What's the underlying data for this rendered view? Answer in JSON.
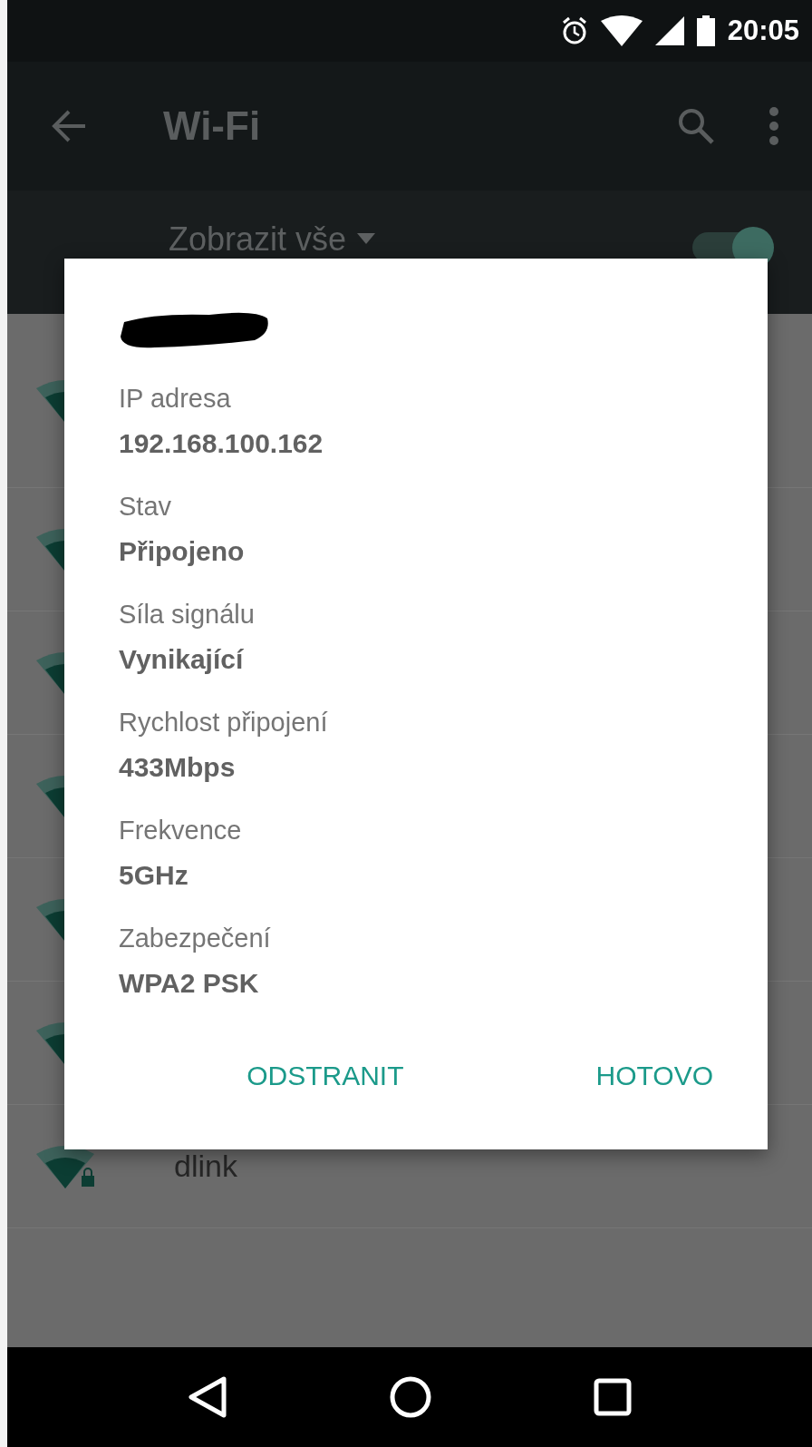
{
  "status_bar": {
    "time": "20:05"
  },
  "toolbar": {
    "title": "Wi-Fi"
  },
  "filter": {
    "label": "Zobrazit vše",
    "wifi_switch": {
      "on": true
    }
  },
  "networks": [
    {
      "name": "dlink",
      "locked": true
    }
  ],
  "dialog": {
    "fields": [
      {
        "label": "IP adresa",
        "value": "192.168.100.162"
      },
      {
        "label": "Stav",
        "value": "Připojeno"
      },
      {
        "label": "Síla signálu",
        "value": "Vynikající"
      },
      {
        "label": "Rychlost připojení",
        "value": "433Mbps"
      },
      {
        "label": "Frekvence",
        "value": "5GHz"
      },
      {
        "label": "Zabezpečení",
        "value": "WPA2 PSK"
      }
    ],
    "buttons": [
      "ODSTRANIT",
      "HOTOVO"
    ]
  }
}
